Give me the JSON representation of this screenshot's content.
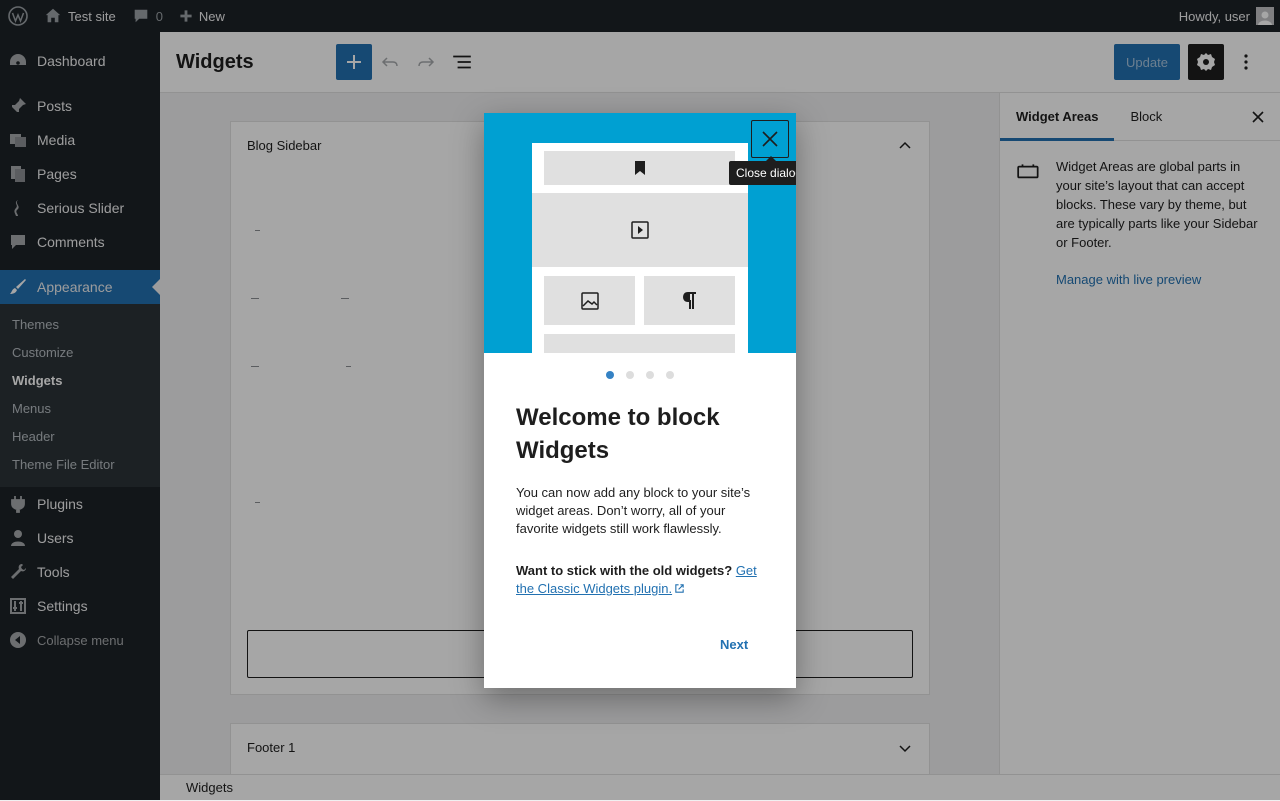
{
  "adminbar": {
    "site_name": "Test site",
    "comments_count": "0",
    "new_label": "New",
    "greeting": "Howdy, user"
  },
  "menu": {
    "items_top": [
      {
        "label": "Dashboard",
        "icon": "dashboard-icon"
      },
      {
        "label": "Posts",
        "icon": "pin-icon"
      },
      {
        "label": "Media",
        "icon": "media-icon"
      },
      {
        "label": "Pages",
        "icon": "pages-icon"
      },
      {
        "label": "Serious Slider",
        "icon": "slider-icon"
      },
      {
        "label": "Comments",
        "icon": "comments-icon"
      }
    ],
    "current": {
      "label": "Appearance",
      "icon": "brush-icon"
    },
    "submenu": [
      "Themes",
      "Customize",
      "Widgets",
      "Menus",
      "Header",
      "Theme File Editor"
    ],
    "submenu_current": "Widgets",
    "items_bottom": [
      {
        "label": "Plugins",
        "icon": "plugins-icon"
      },
      {
        "label": "Users",
        "icon": "users-icon"
      },
      {
        "label": "Tools",
        "icon": "tools-icon"
      },
      {
        "label": "Settings",
        "icon": "settings-icon"
      }
    ],
    "collapse_label": "Collapse menu"
  },
  "header": {
    "title": "Widgets",
    "update_label": "Update"
  },
  "areas": {
    "blog_sidebar": "Blog Sidebar",
    "footer1": "Footer 1"
  },
  "sidebar": {
    "tab_widget_areas": "Widget Areas",
    "tab_block": "Block",
    "description": "Widget Areas are global parts in your site’s layout that can accept blocks. These vary by theme, but are typically parts like your Sidebar or Footer.",
    "link": "Manage with live preview"
  },
  "footer": {
    "breadcrumb": "Widgets"
  },
  "modal": {
    "tooltip": "Close dialog",
    "title": "Welcome to block Widgets",
    "text": "You can now add any block to your site’s widget areas. Don’t worry, all of your favorite widgets still work flawlessly.",
    "classic_prefix": "Want to stick with the old widgets?",
    "classic_link": "Get the Classic Widgets plugin.",
    "next_label": "Next",
    "page_dots": 4,
    "current_page": 1
  },
  "colors": {
    "accent": "#2271b1",
    "admin_dark": "#1d2327",
    "hero_blue": "#00a0d2"
  }
}
